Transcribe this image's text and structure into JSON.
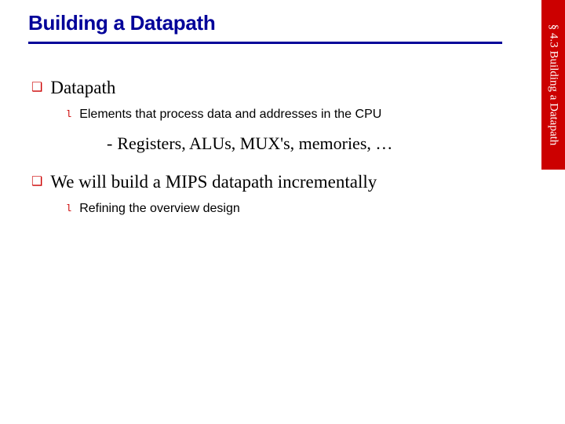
{
  "title": "Building a Datapath",
  "side_tab": "§ 4.3 Building a Datapath",
  "items": [
    {
      "text": "Datapath",
      "children": [
        {
          "text": "Elements that process data and addresses in the CPU",
          "children": [
            {
              "text": "Registers, ALUs, MUX's, memories, …"
            }
          ]
        }
      ]
    },
    {
      "text": "We will build a MIPS datapath incrementally",
      "children": [
        {
          "text": "Refining the overview design"
        }
      ]
    }
  ]
}
